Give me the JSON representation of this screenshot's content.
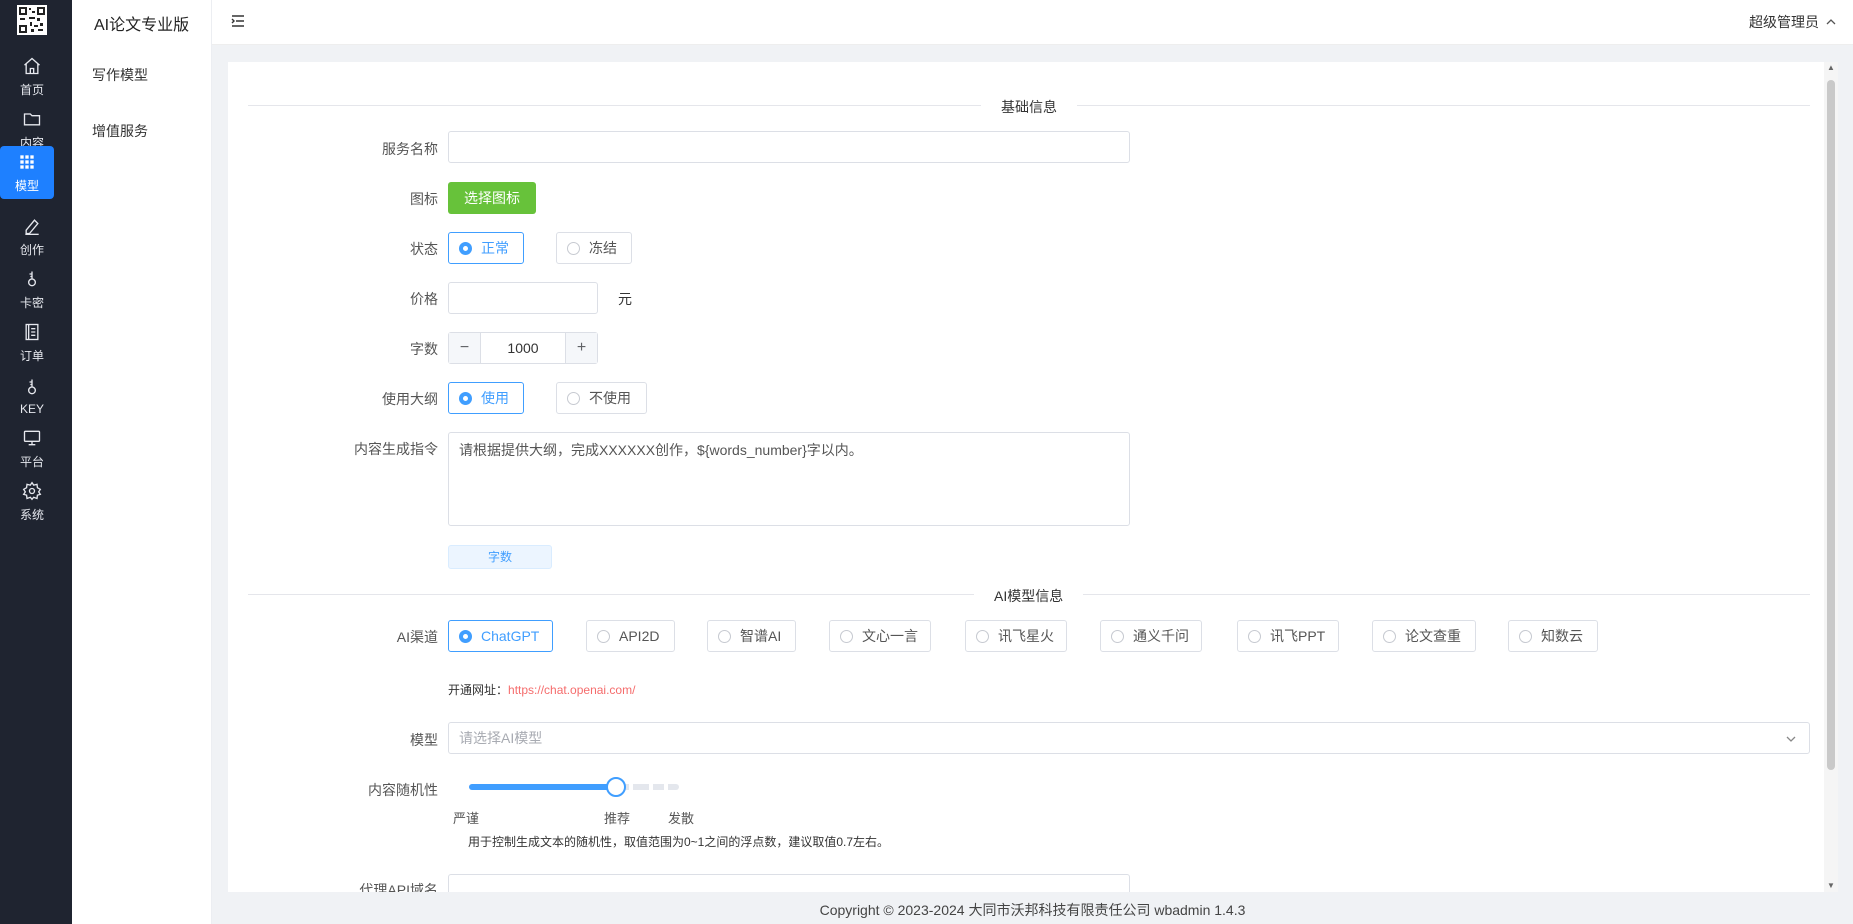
{
  "app": {
    "brand": "AI论文专业版"
  },
  "rail": [
    {
      "label": "首页",
      "icon": "home-icon"
    },
    {
      "label": "内容",
      "icon": "folder-icon"
    },
    {
      "label": "模型",
      "icon": "grid-icon",
      "active": true
    },
    {
      "label": "创作",
      "icon": "pen-icon"
    },
    {
      "label": "卡密",
      "icon": "key-icon"
    },
    {
      "label": "订单",
      "icon": "order-icon"
    },
    {
      "label": "KEY",
      "icon": "key-icon"
    },
    {
      "label": "平台",
      "icon": "monitor-icon"
    },
    {
      "label": "系统",
      "icon": "gear-icon"
    }
  ],
  "submenu": [
    {
      "label": "写作模型"
    },
    {
      "label": "增值服务"
    }
  ],
  "header": {
    "user": "超级管理员"
  },
  "form": {
    "section_basic": "基础信息",
    "service_name_label": "服务名称",
    "service_name_value": "",
    "icon_label": "图标",
    "choose_icon": "选择图标",
    "status_label": "状态",
    "status_options": [
      "正常",
      "冻结"
    ],
    "status_selected": "正常",
    "price_label": "价格",
    "price_value": "",
    "price_unit": "元",
    "words_label": "字数",
    "words_value": "1000",
    "words_minus": "−",
    "words_plus": "+",
    "outline_label": "使用大纲",
    "outline_options": [
      "使用",
      "不使用"
    ],
    "outline_selected": "使用",
    "prompt_label": "内容生成指令",
    "prompt_value": "请根据提供大纲，完成XXXXXX创作，${words_number}字以内。",
    "words_tag": "字数",
    "section_ai": "AI模型信息",
    "channel_label": "AI渠道",
    "channels": [
      "ChatGPT",
      "API2D",
      "智谱AI",
      "文心一言",
      "讯飞星火",
      "通义千问",
      "讯飞PPT",
      "论文查重",
      "知数云"
    ],
    "channel_selected": "ChatGPT",
    "open_url_label": "开通网址：",
    "open_url": "https://chat.openai.com/",
    "model_label": "模型",
    "model_placeholder": "请选择AI模型",
    "randomness_label": "内容随机性",
    "randomness_value": 0.7,
    "randomness_marks": [
      "严谨",
      "推荐",
      "发散"
    ],
    "randomness_note": "用于控制生成文本的随机性，取值范围为0~1之间的浮点数，建议取值0.7左右。",
    "proxy_label": "代理API域名"
  },
  "footer": "Copyright © 2023-2024 大同市沃邦科技有限责任公司   wbadmin 1.4.3"
}
